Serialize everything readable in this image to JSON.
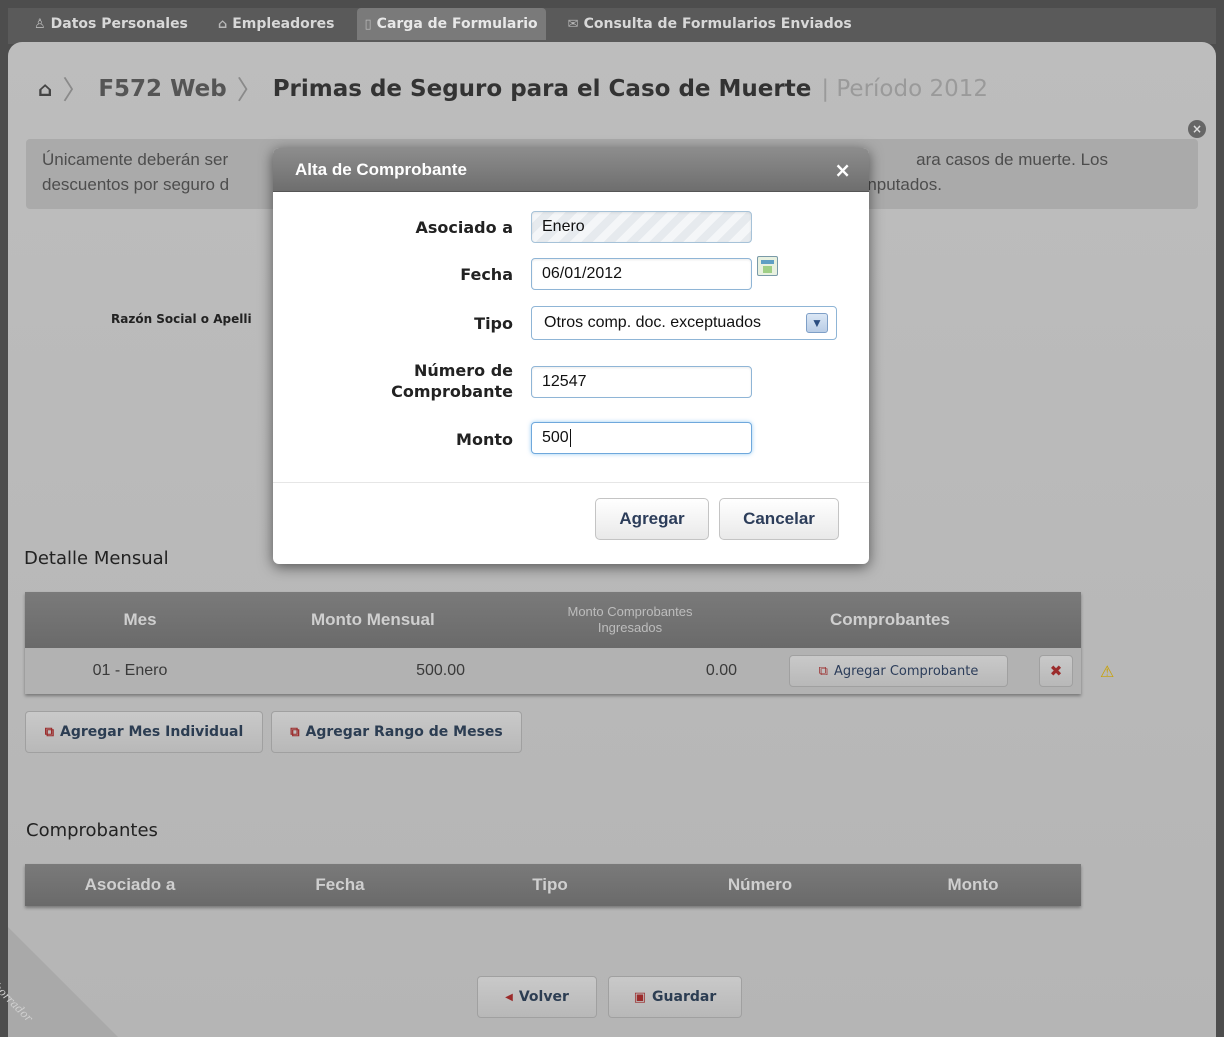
{
  "nav": {
    "tabs": [
      {
        "label": "Datos Personales",
        "icon": "person-icon"
      },
      {
        "label": "Empleadores",
        "icon": "building-icon"
      },
      {
        "label": "Carga de Formulario",
        "icon": "document-icon",
        "active": true
      },
      {
        "label": "Consulta de Formularios Enviados",
        "icon": "envelope-icon"
      }
    ]
  },
  "breadcrumb": {
    "root": "F572 Web",
    "current": "Primas de Seguro para el Caso de Muerte",
    "period": "| Período 2012"
  },
  "info": {
    "line1_left": "Únicamente deberán ser",
    "line1_right": "ara casos de muerte. Los",
    "line2_left": "descuentos por seguro d",
    "line2_right": "nputados."
  },
  "form_bg": {
    "razon_label": "Razón Social o Apelli"
  },
  "modal": {
    "title": "Alta de Comprobante",
    "close": "×",
    "fields": {
      "asociado_label": "Asociado a",
      "asociado_value": "Enero",
      "fecha_label": "Fecha",
      "fecha_value": "06/01/2012",
      "tipo_label": "Tipo",
      "tipo_value": "Otros comp. doc. exceptuados",
      "numero_label_1": "Número de",
      "numero_label_2": "Comprobante",
      "numero_value": "12547",
      "monto_label": "Monto",
      "monto_value": "500"
    },
    "buttons": {
      "agregar": "Agregar",
      "cancelar": "Cancelar"
    }
  },
  "detalle": {
    "title": "Detalle Mensual",
    "headers": {
      "mes": "Mes",
      "monto_mensual": "Monto Mensual",
      "monto_comprobantes_1": "Monto Comprobantes",
      "monto_comprobantes_2": "Ingresados",
      "comprobantes": "Comprobantes"
    },
    "rows": [
      {
        "mes": "01 - Enero",
        "monto_mensual": "500.00",
        "monto_comprobantes": "0.00",
        "action": "Agregar Comprobante"
      }
    ],
    "buttons": {
      "agregar_mes": "Agregar Mes Individual",
      "agregar_rango": "Agregar Rango de Meses"
    }
  },
  "comprobantes": {
    "title": "Comprobantes",
    "headers": [
      "Asociado a",
      "Fecha",
      "Tipo",
      "Número",
      "Monto"
    ]
  },
  "footer": {
    "volver": "Volver",
    "guardar": "Guardar",
    "ribbon": "borrador"
  },
  "colors": {
    "overlay_bg": "#b9b9b9",
    "header_bg": "#6e6e6e",
    "button_text": "#2c3d5a",
    "danger": "#9b2b2b",
    "warning": "#e0b000"
  }
}
